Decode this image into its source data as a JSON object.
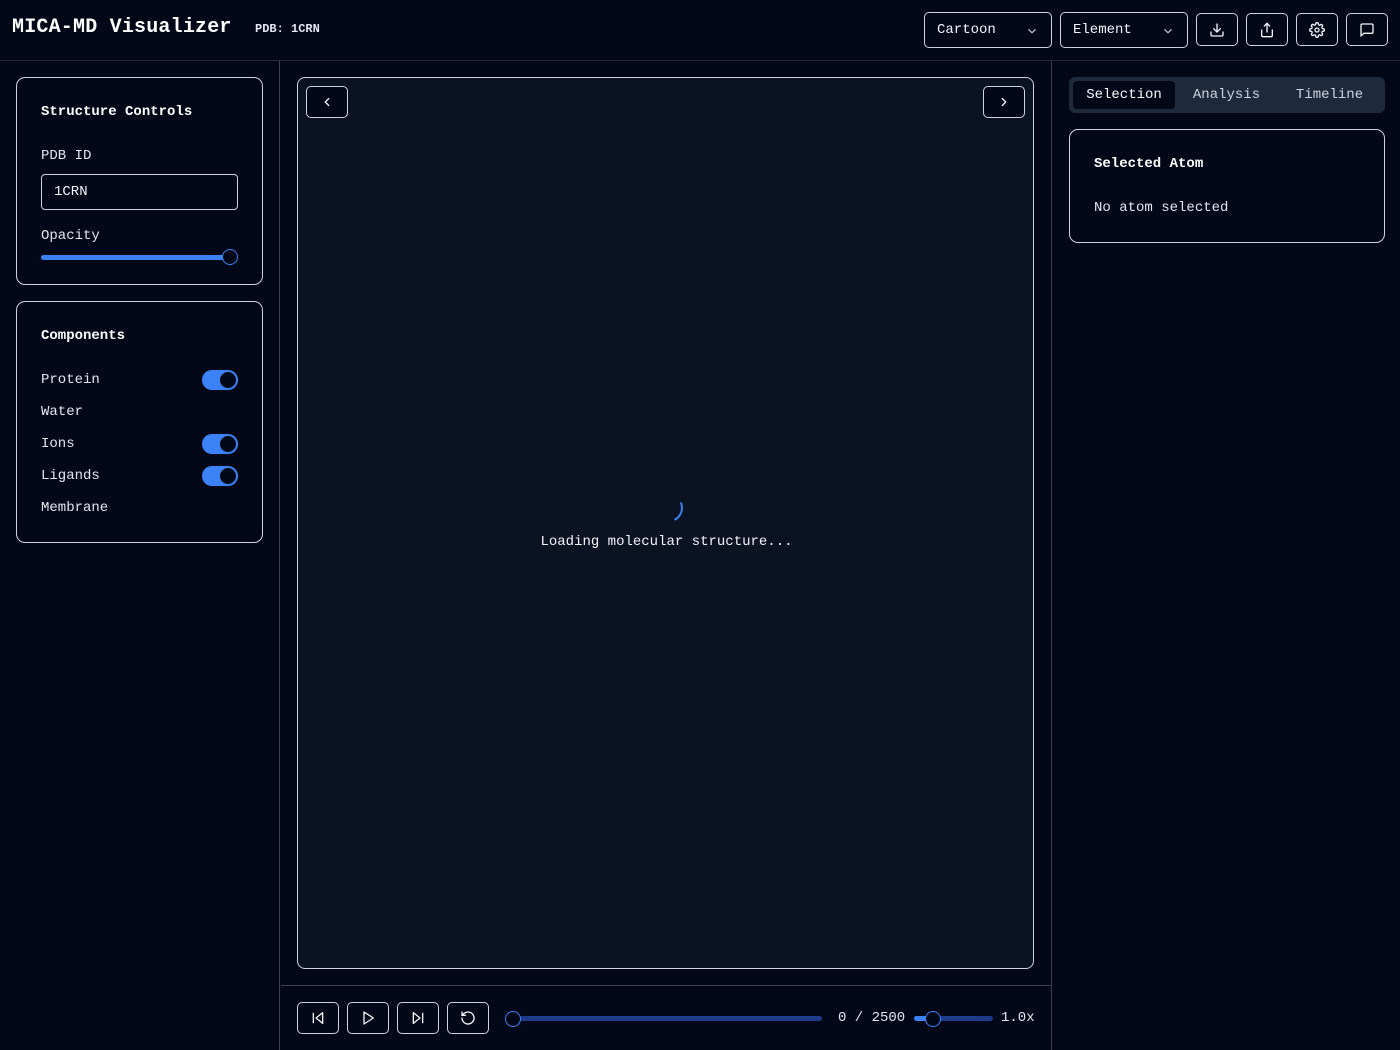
{
  "header": {
    "app_title": "MICA-MD Visualizer",
    "pdb_badge": "PDB: 1CRN",
    "representation_select": {
      "value": "Cartoon"
    },
    "color_select": {
      "value": "Element"
    },
    "icons": [
      "download-icon",
      "share-icon",
      "settings-icon",
      "chat-icon"
    ]
  },
  "structure_controls": {
    "title": "Structure Controls",
    "pdb_label": "PDB ID",
    "pdb_value": "1CRN",
    "opacity_label": "Opacity",
    "opacity_value": 1.0
  },
  "components": {
    "title": "Components",
    "items": [
      {
        "label": "Protein",
        "enabled": true
      },
      {
        "label": "Water",
        "enabled": false
      },
      {
        "label": "Ions",
        "enabled": true
      },
      {
        "label": "Ligands",
        "enabled": true
      },
      {
        "label": "Membrane",
        "enabled": false
      }
    ]
  },
  "viewer": {
    "loading_text": "Loading molecular structure...",
    "prev_icon": "chevron-left-icon",
    "next_icon": "chevron-right-icon"
  },
  "playback": {
    "current_frame": "0",
    "separator": "/",
    "total_frames": "2500",
    "frame_display": "0 / 2500",
    "progress": 0,
    "speed_label": "1.0x",
    "speed_fraction": 0.25,
    "buttons": [
      "skip-back-icon",
      "play-icon",
      "skip-forward-icon",
      "reset-icon"
    ]
  },
  "right_panel": {
    "tabs": [
      "Selection",
      "Analysis",
      "Timeline"
    ],
    "active_tab": "Selection",
    "selected_atom": {
      "title": "Selected Atom",
      "empty_text": "No atom selected"
    }
  },
  "colors": {
    "background": "#020817",
    "accent": "#3b82f6",
    "border": "#cbd5e1"
  }
}
